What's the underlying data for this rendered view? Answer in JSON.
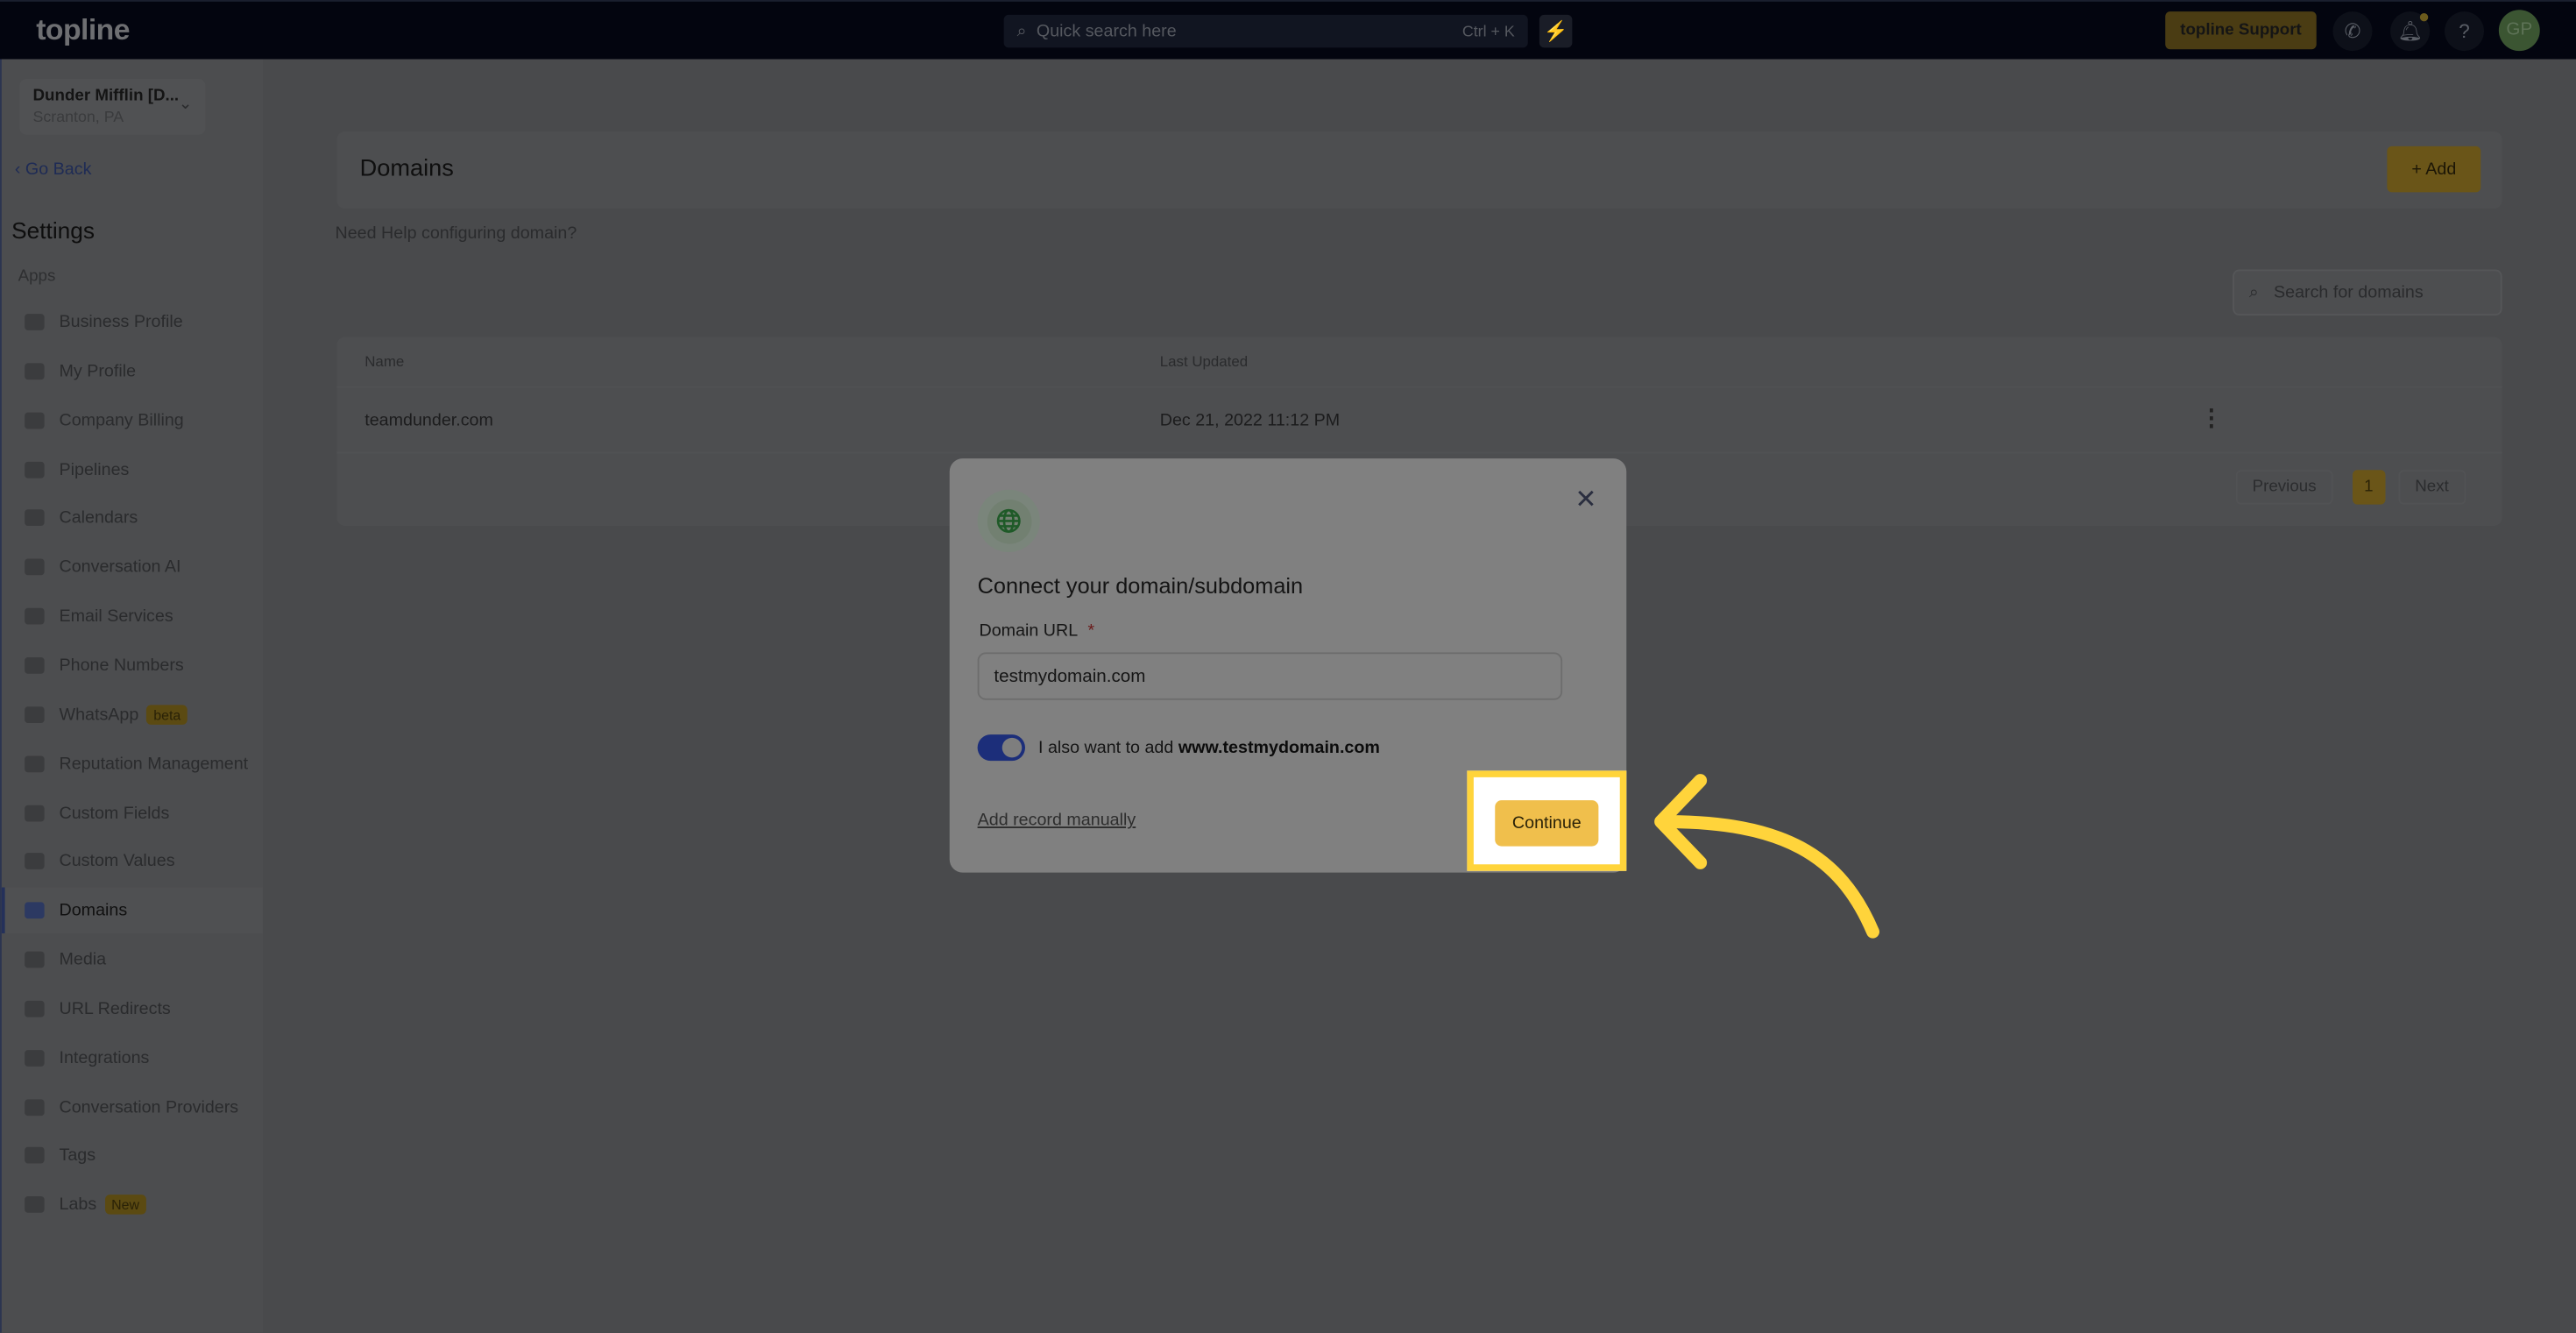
{
  "topbar": {
    "logo": "topline",
    "search_placeholder": "Quick search here",
    "search_shortcut": "Ctrl + K",
    "support_label": "topline Support",
    "avatar_initials": "GP"
  },
  "sidebar": {
    "account_name": "Dunder Mifflin [D...",
    "account_location": "Scranton, PA",
    "go_back": "Go Back",
    "title": "Settings",
    "section": "Apps",
    "items": [
      {
        "label": "Business Profile"
      },
      {
        "label": "My Profile"
      },
      {
        "label": "Company Billing"
      },
      {
        "label": "Pipelines"
      },
      {
        "label": "Calendars"
      },
      {
        "label": "Conversation AI"
      },
      {
        "label": "Email Services"
      },
      {
        "label": "Phone Numbers"
      },
      {
        "label": "WhatsApp",
        "badge": "beta"
      },
      {
        "label": "Reputation Management"
      },
      {
        "label": "Custom Fields"
      },
      {
        "label": "Custom Values"
      },
      {
        "label": "Domains",
        "active": true
      },
      {
        "label": "Media"
      },
      {
        "label": "URL Redirects"
      },
      {
        "label": "Integrations"
      },
      {
        "label": "Conversation Providers"
      },
      {
        "label": "Tags"
      },
      {
        "label": "Labs",
        "badge": "New"
      }
    ]
  },
  "main": {
    "title": "Domains",
    "add_label": "+ Add",
    "help": "Need Help configuring domain?",
    "search_placeholder": "Search for domains",
    "columns": [
      "Name",
      "Last Updated"
    ],
    "rows": [
      {
        "name": "teamdunder.com",
        "updated": "Dec 21, 2022 11:12 PM"
      }
    ],
    "pagination": {
      "previous": "Previous",
      "current": "1",
      "next": "Next"
    }
  },
  "modal": {
    "title": "Connect your domain/subdomain",
    "field_label": "Domain URL",
    "required_mark": "*",
    "field_value": "testmydomain.com",
    "toggle_on": true,
    "toggle_text": "I also want to add ",
    "toggle_domain": "www.testmydomain.com",
    "manual_link": "Add record manually",
    "continue_label": "Continue"
  },
  "colors": {
    "highlight": "#ffd43b",
    "continue": "#f0bf4c",
    "toggle": "#1c2e7a"
  }
}
